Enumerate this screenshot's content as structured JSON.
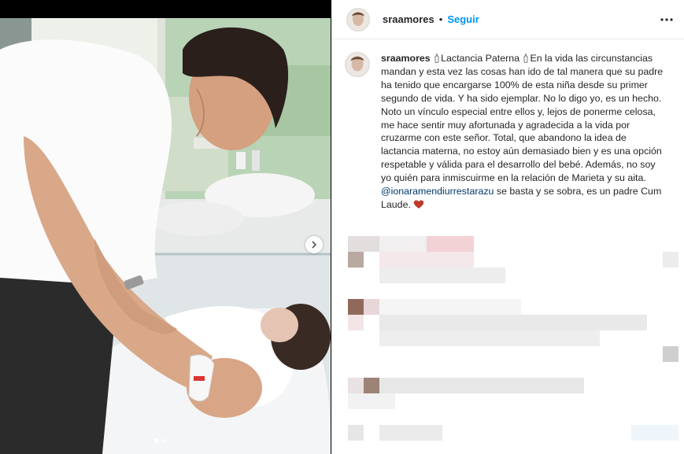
{
  "post": {
    "username": "sraamores",
    "separator": "•",
    "follow_label": "Seguir",
    "caption": {
      "username": "sraamores",
      "part1": "Lactancia Paterna",
      "part2": "En la vida las circunstancias mandan y esta vez las cosas han ido de tal manera que su padre ha tenido que encargarse 100% de esta niña desde su primer segundo de vida. Y ha sido ejemplar. No lo digo yo, es un hecho. Noto un vínculo especial entre ellos y, lejos de ponerme celosa, me hace sentir muy afortunada y agradecida a la vida por cruzarme con este señor. Total, que abandono la idea de lactancia materna, no estoy aún demasiado bien y es una opción respetable y válida para el desarrollo del bebé. Además, no soy yo quién para inmiscuirme en la relación de Marieta y su aita.",
      "mention": "@ionaramendiurrestarazu",
      "part3": "se basta y se sobra, es un padre Cum Laude."
    }
  },
  "carousel": {
    "slide_count": 2,
    "active_slide": 1
  },
  "icons": {
    "more": "more-options-icon",
    "next": "chevron-right-icon",
    "bottle": "baby-bottle-icon",
    "heart": "red-heart-icon"
  },
  "colors": {
    "link": "#0095f6",
    "mention": "#00376b",
    "heart": "#c0392b",
    "text": "#262626"
  }
}
